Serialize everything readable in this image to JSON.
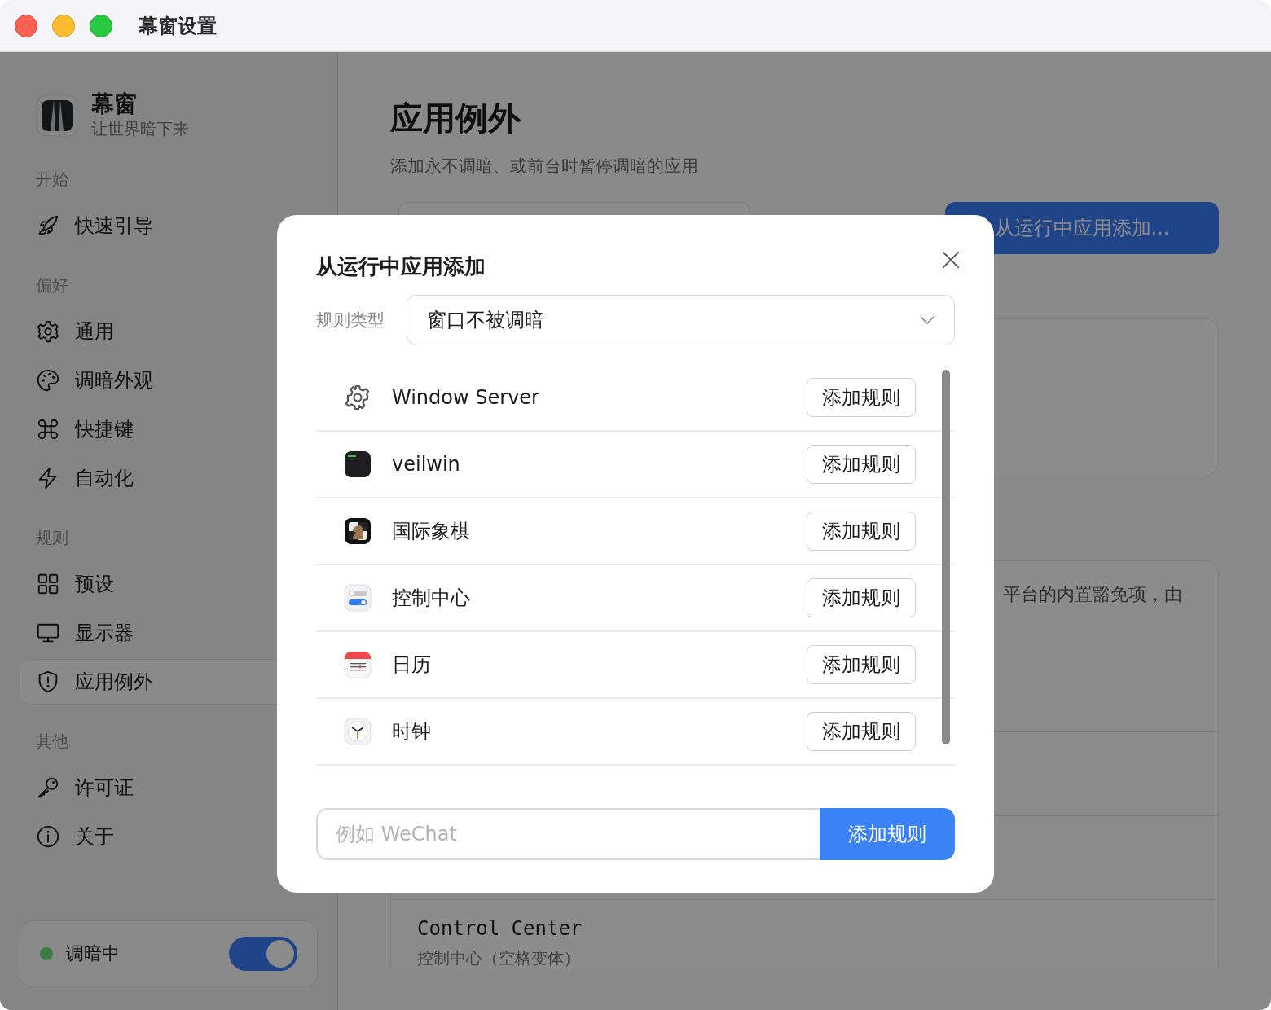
{
  "window": {
    "title": "幕窗设置"
  },
  "sidebar": {
    "app": {
      "name": "幕窗",
      "tagline": "让世界暗下来"
    },
    "sections": [
      {
        "title": "开始",
        "items": [
          {
            "label": "快速引导",
            "selected": false
          }
        ]
      },
      {
        "title": "偏好",
        "items": [
          {
            "label": "通用",
            "selected": false
          },
          {
            "label": "调暗外观",
            "selected": false
          },
          {
            "label": "快捷键",
            "selected": false
          },
          {
            "label": "自动化",
            "selected": false
          }
        ]
      },
      {
        "title": "规则",
        "items": [
          {
            "label": "预设",
            "selected": false
          },
          {
            "label": "显示器",
            "selected": false
          },
          {
            "label": "应用例外",
            "selected": true
          }
        ]
      },
      {
        "title": "其他",
        "items": [
          {
            "label": "许可证",
            "selected": false
          },
          {
            "label": "关于",
            "selected": false
          }
        ]
      }
    ],
    "status": {
      "label": "调暗中",
      "color": "#3d7d45",
      "on": true
    }
  },
  "page": {
    "title": "应用例外",
    "subtitle": "添加永不调暗、或前台时暂停调暗的应用",
    "add_button": "从运行中应用添加...",
    "note": "平台的内置豁免项，由",
    "rows": [
      {
        "title": "Control Center",
        "subtitle": "控制中心（空格变体）"
      }
    ]
  },
  "dialog": {
    "title": "从运行中应用添加",
    "rule_type": {
      "label": "规则类型",
      "value": "窗口不被调暗"
    },
    "apps": [
      {
        "name": "Window Server",
        "action": "添加规则"
      },
      {
        "name": "veilwin",
        "action": "添加规则"
      },
      {
        "name": "国际象棋",
        "action": "添加规则"
      },
      {
        "name": "控制中心",
        "action": "添加规则"
      },
      {
        "name": "日历",
        "action": "添加规则"
      },
      {
        "name": "时钟",
        "action": "添加规则"
      }
    ],
    "search": {
      "placeholder": "例如 WeChat"
    },
    "submit": "添加规则"
  }
}
